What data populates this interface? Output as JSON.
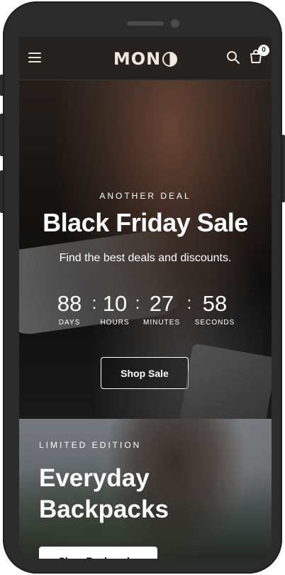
{
  "header": {
    "logo_text": "MON",
    "cart_count": "0",
    "icons": {
      "menu": "hamburger-menu-icon",
      "search": "search-icon",
      "cart": "shopping-bag-icon"
    }
  },
  "hero_primary": {
    "eyebrow": "ANOTHER DEAL",
    "title": "Black Friday Sale",
    "subtitle": "Find the best deals and discounts.",
    "countdown": [
      {
        "value": "88",
        "label": "DAYS"
      },
      {
        "value": "10",
        "label": "HOURS"
      },
      {
        "value": "27",
        "label": "MINUTES"
      },
      {
        "value": "58",
        "label": "SECONDS"
      }
    ],
    "separator": ":",
    "cta_label": "Shop Sale"
  },
  "hero_secondary": {
    "eyebrow": "LIMITED EDITION",
    "title_lines": [
      "Everyday",
      "Backpacks"
    ],
    "cta_label": "Shop Backpacks"
  },
  "colors": {
    "header_bg": "#26221f",
    "text_on_dark": "#ffffff",
    "phone_frame": "#2b2b2b"
  }
}
